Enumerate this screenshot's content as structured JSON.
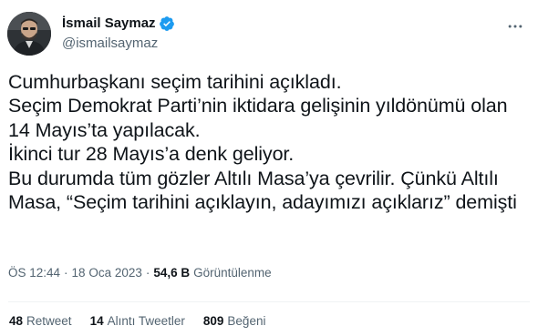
{
  "author": {
    "display_name": "İsmail Saymaz",
    "handle": "@ismailsaymaz",
    "verified": true
  },
  "tweet": {
    "text": "Cumhurbaşkanı seçim tarihini açıkladı.\nSeçim Demokrat Parti’nin iktidara gelişinin yıldönümü olan 14 Mayıs’ta yapılacak.\nİkinci tur 28 Mayıs’a denk geliyor.\nBu durumda tüm gözler Altılı Masa’ya çevrilir. Çünkü Altılı Masa, “Seçim tarihini açıklayın, adayımızı açıklarız” demişti",
    "time": "ÖS 12:44",
    "date": "18 Oca 2023",
    "separator": "·",
    "views_count": "54,6 B",
    "views_label": "Görüntülenme"
  },
  "stats": {
    "retweets_count": "48",
    "retweets_label": "Retweet",
    "quotes_count": "14",
    "quotes_label": "Alıntı Tweetler",
    "likes_count": "809",
    "likes_label": "Beğeni"
  },
  "colors": {
    "text_primary": "#0f1419",
    "text_secondary": "#536471",
    "verified_blue": "#1d9bf0",
    "divider": "#eff3f4"
  },
  "icons": {
    "verified": "verified-badge-icon",
    "more": "more-options-icon"
  }
}
